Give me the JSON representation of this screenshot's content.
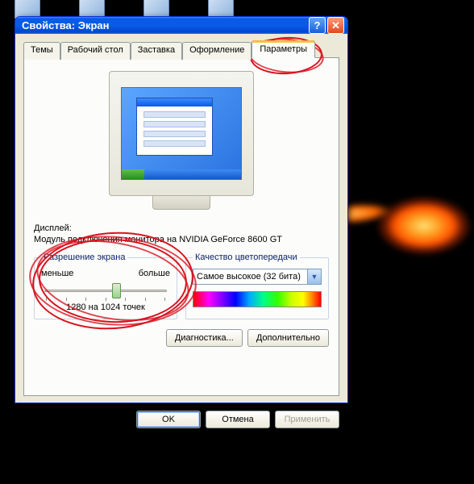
{
  "window": {
    "title": "Свойства: Экран"
  },
  "tabs": {
    "t0": "Темы",
    "t1": "Рабочий стол",
    "t2": "Заставка",
    "t3": "Оформление",
    "t4": "Параметры",
    "active": "Параметры"
  },
  "display": {
    "label": "Дисплей:",
    "value": "Модуль подключения монитора на NVIDIA GeForce 8600 GT"
  },
  "resolution": {
    "legend": "Разрешение экрана",
    "min_label": "меньше",
    "max_label": "больше",
    "value_text": "1280 на 1024 точек"
  },
  "quality": {
    "legend": "Качество цветопередачи",
    "selected": "Самое высокое (32 бита)"
  },
  "panel_buttons": {
    "diag": "Диагностика...",
    "adv": "Дополнительно"
  },
  "dialog_buttons": {
    "ok": "OK",
    "cancel": "Отмена",
    "apply": "Применить"
  }
}
